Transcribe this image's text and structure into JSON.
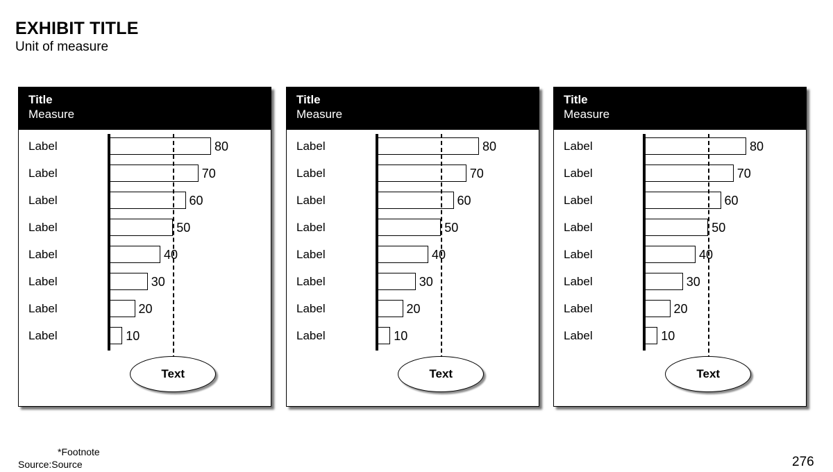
{
  "exhibit": {
    "title": "EXHIBIT TITLE",
    "subtitle": "Unit of measure"
  },
  "footer": {
    "footnote": "*Footnote",
    "source": "Source:Source",
    "page_number": "276"
  },
  "colors": {
    "header_background": "#000000",
    "header_text": "#ffffff",
    "bar_fill": "#ffffff",
    "bar_outline": "#000000",
    "axis": "#000000",
    "reference_line": "#000000",
    "page_background": "#ffffff"
  },
  "panels": [
    {
      "title": "Title",
      "measure": "Measure",
      "callout": "Text",
      "chart_data": {
        "type": "bar",
        "orientation": "horizontal",
        "title": "Title",
        "subtitle": "Measure",
        "xlabel": "",
        "ylabel": "",
        "xlim": [
          0,
          90
        ],
        "grid": false,
        "legend": false,
        "reference_line": 50,
        "categories": [
          "Label",
          "Label",
          "Label",
          "Label",
          "Label",
          "Label",
          "Label",
          "Label"
        ],
        "values": [
          80,
          70,
          60,
          50,
          40,
          30,
          20,
          10
        ],
        "value_labels": [
          "80",
          "70",
          "60",
          "50",
          "40",
          "30",
          "20",
          "10"
        ],
        "annotation": "Text"
      }
    },
    {
      "title": "Title",
      "measure": "Measure",
      "callout": "Text",
      "chart_data": {
        "type": "bar",
        "orientation": "horizontal",
        "title": "Title",
        "subtitle": "Measure",
        "xlabel": "",
        "ylabel": "",
        "xlim": [
          0,
          90
        ],
        "grid": false,
        "legend": false,
        "reference_line": 50,
        "categories": [
          "Label",
          "Label",
          "Label",
          "Label",
          "Label",
          "Label",
          "Label",
          "Label"
        ],
        "values": [
          80,
          70,
          60,
          50,
          40,
          30,
          20,
          10
        ],
        "value_labels": [
          "80",
          "70",
          "60",
          "50",
          "40",
          "30",
          "20",
          "10"
        ],
        "annotation": "Text"
      }
    },
    {
      "title": "Title",
      "measure": "Measure",
      "callout": "Text",
      "chart_data": {
        "type": "bar",
        "orientation": "horizontal",
        "title": "Title",
        "subtitle": "Measure",
        "xlabel": "",
        "ylabel": "",
        "xlim": [
          0,
          90
        ],
        "grid": false,
        "legend": false,
        "reference_line": 50,
        "categories": [
          "Label",
          "Label",
          "Label",
          "Label",
          "Label",
          "Label",
          "Label",
          "Label"
        ],
        "values": [
          80,
          70,
          60,
          50,
          40,
          30,
          20,
          10
        ],
        "value_labels": [
          "80",
          "70",
          "60",
          "50",
          "40",
          "30",
          "20",
          "10"
        ],
        "annotation": "Text"
      }
    }
  ],
  "chart_data": {
    "type": "bar",
    "orientation": "horizontal",
    "title": "EXHIBIT TITLE",
    "subtitle": "Unit of measure",
    "xlabel": "",
    "ylabel": "",
    "xlim": [
      0,
      90
    ],
    "grid": false,
    "legend": false,
    "reference_line": 50,
    "panel_count": 3,
    "categories": [
      "Label",
      "Label",
      "Label",
      "Label",
      "Label",
      "Label",
      "Label",
      "Label"
    ],
    "series": [
      {
        "name": "Title",
        "values": [
          80,
          70,
          60,
          50,
          40,
          30,
          20,
          10
        ]
      },
      {
        "name": "Title",
        "values": [
          80,
          70,
          60,
          50,
          40,
          30,
          20,
          10
        ]
      },
      {
        "name": "Title",
        "values": [
          80,
          70,
          60,
          50,
          40,
          30,
          20,
          10
        ]
      }
    ],
    "annotations": [
      "Text",
      "Text",
      "Text"
    ]
  }
}
